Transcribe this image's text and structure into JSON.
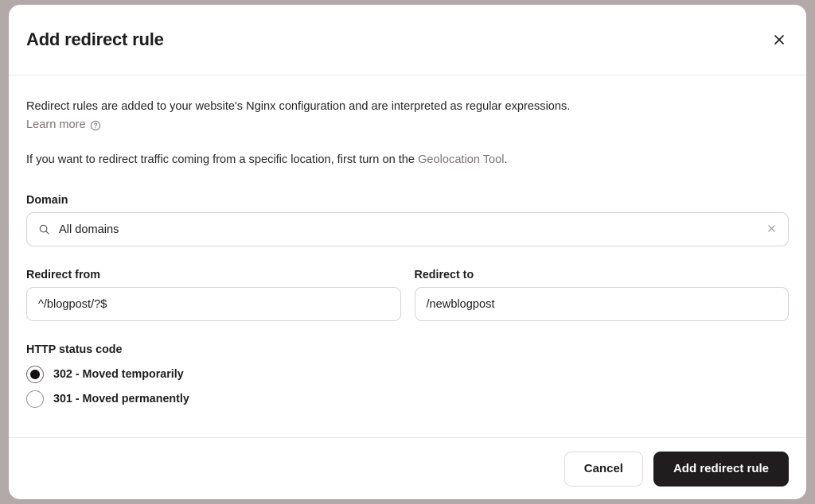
{
  "modal": {
    "title": "Add redirect rule",
    "close_icon": "close-icon"
  },
  "description": {
    "line1": "Redirect rules are added to your website's Nginx configuration and are interpreted as regular expressions.",
    "learn_more_label": "Learn more",
    "help_icon": "help-circle-icon",
    "line2_prefix": "If you want to redirect traffic coming from a specific location, first turn on the ",
    "line2_link": "Geolocation Tool",
    "line2_suffix": "."
  },
  "domain": {
    "label": "Domain",
    "value": "All domains",
    "placeholder": "All domains",
    "search_icon": "search-icon",
    "clear_icon": "clear-icon"
  },
  "redirect_from": {
    "label": "Redirect from",
    "value": "^/blogpost/?$",
    "placeholder": "^/blogpost/?$"
  },
  "redirect_to": {
    "label": "Redirect to",
    "value": "/newblogpost",
    "placeholder": "/newblogpost"
  },
  "status_code": {
    "label": "HTTP status code",
    "options": [
      {
        "label": "302 - Moved temporarily",
        "value": "302",
        "selected": true
      },
      {
        "label": "301 - Moved permanently",
        "value": "301",
        "selected": false
      }
    ]
  },
  "footer": {
    "cancel_label": "Cancel",
    "submit_label": "Add redirect rule"
  },
  "colors": {
    "backdrop": "#b3a9a8",
    "surface": "#ffffff",
    "text": "#1d1d1d",
    "muted": "#7a7472",
    "border": "#d8d2d1",
    "divider": "#eceaea",
    "primary_button": "#1f1d1d"
  }
}
